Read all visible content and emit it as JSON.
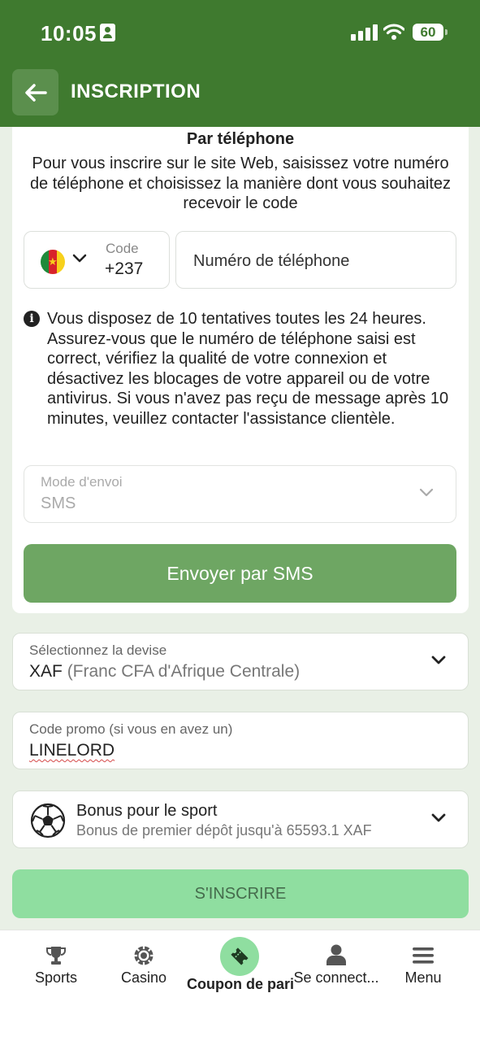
{
  "status_bar": {
    "time": "10:05",
    "battery": "60"
  },
  "header": {
    "title": "INSCRIPTION"
  },
  "phone_section": {
    "title": "Par téléphone",
    "intro": "Pour vous inscrire sur le site Web, saisissez votre numéro de téléphone et choisissez la manière dont vous souhaitez recevoir le code",
    "code_label": "Code",
    "code_value": "+237",
    "phone_placeholder": "Numéro de téléphone",
    "info_text": "Vous disposez de 10 tentatives toutes les 24 heures. Assurez-vous que le numéro de téléphone saisi est correct, vérifiez la qualité de votre connexion et désactivez les blocages de votre appareil ou de votre antivirus. Si vous n'avez pas reçu de message après 10 minutes, veuillez contacter l'assistance clientèle.",
    "send_mode_label": "Mode d'envoi",
    "send_mode_value": "SMS",
    "send_button": "Envoyer par SMS"
  },
  "currency": {
    "label": "Sélectionnez la devise",
    "code": "XAF",
    "name": "(Franc CFA d'Afrique Centrale)"
  },
  "promo": {
    "label": "Code promo (si vous en avez un)",
    "value": "LINELORD"
  },
  "bonus": {
    "title": "Bonus pour le sport",
    "subtitle": "Bonus de premier dépôt jusqu'à 65593.1 XAF"
  },
  "register_button": "S'INSCRIRE",
  "bottom_nav": {
    "sports": "Sports",
    "casino": "Casino",
    "coupon": "Coupon de pari",
    "login": "Se connect...",
    "menu": "Menu"
  },
  "colors": {
    "brand_green": "#3f7a2f",
    "send_button": "#6ea663",
    "register_button": "#8fdea0",
    "flag": [
      "#1f8a3a",
      "#d8232a",
      "#f7d11c"
    ]
  },
  "icons": [
    "person-id-icon",
    "signal-icon",
    "wifi-icon",
    "battery-icon",
    "back-arrow-icon",
    "cameroon-flag-icon",
    "chevron-down-icon",
    "info-icon",
    "soccer-ball-icon",
    "trophy-icon",
    "casino-chip-icon",
    "ticket-icon",
    "user-icon",
    "menu-icon"
  ]
}
